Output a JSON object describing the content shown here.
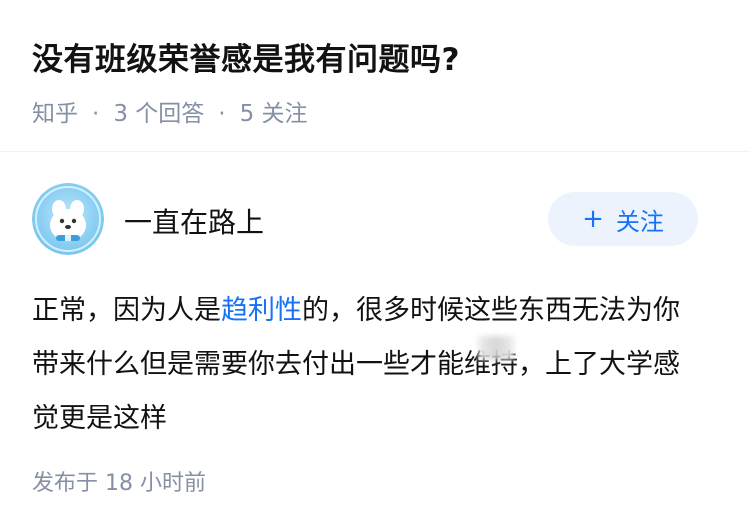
{
  "question": {
    "title": "没有班级荣誉感是我有问题吗?",
    "source": "知乎",
    "answers_count": "3 个回答",
    "followers_count": "5 关注"
  },
  "answer": {
    "author_name": "一直在路上",
    "follow_label": "关注",
    "follow_icon": "plus-icon",
    "text_before_link": "正常，因为人是",
    "link_text": "趋利性",
    "text_after_link": "的，很多时候这些东西无法为你带来什么但是需要你去付出一些才能维持，上了大学感觉更是这样",
    "publish_time": "发布于 18 小时前"
  },
  "colors": {
    "accent": "#1772f6",
    "meta_text": "#8590a6",
    "follow_bg": "#ecf3fd"
  }
}
